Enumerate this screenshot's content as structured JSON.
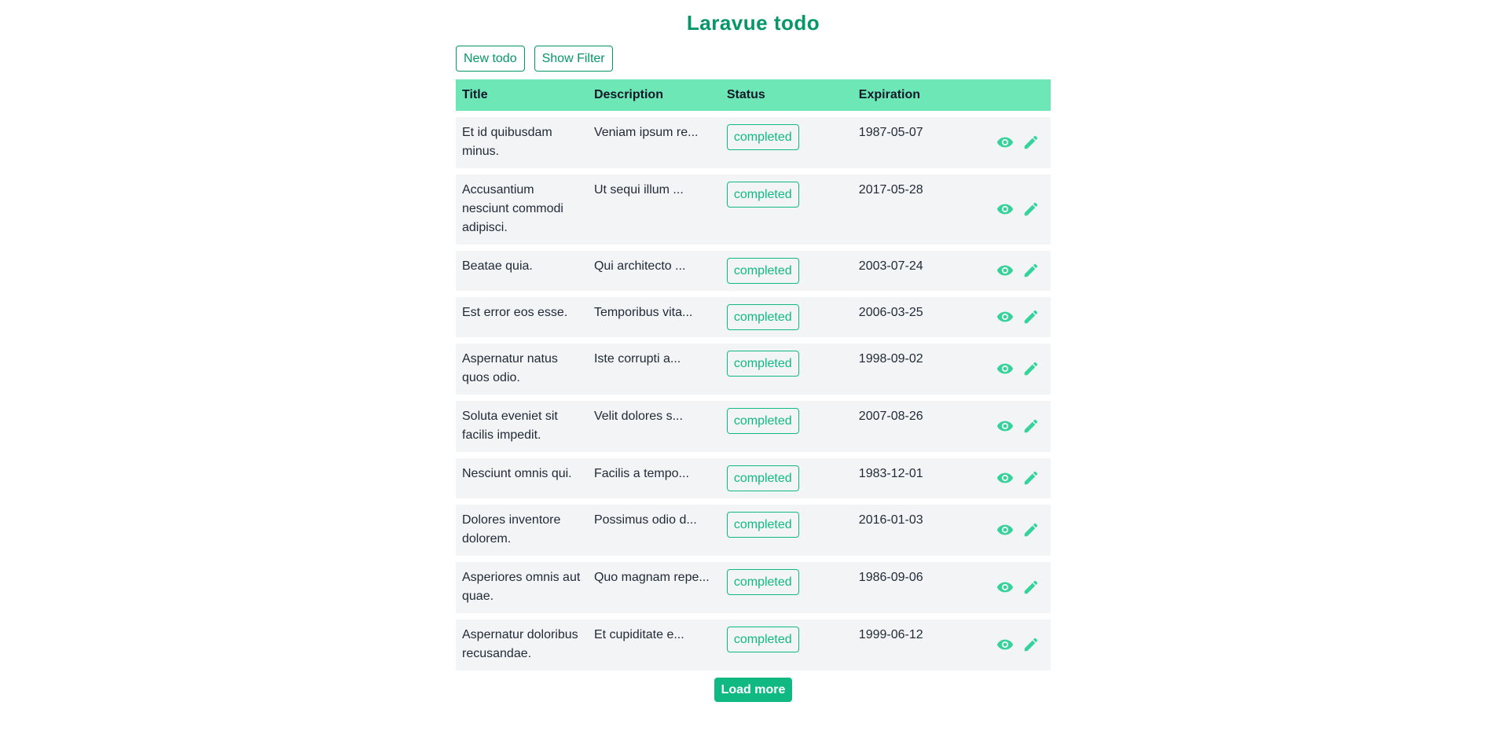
{
  "app": {
    "title": "Laravue todo"
  },
  "toolbar": {
    "new_todo_label": "New todo",
    "show_filter_label": "Show Filter"
  },
  "table": {
    "headers": {
      "title": "Title",
      "description": "Description",
      "status": "Status",
      "expiration": "Expiration"
    },
    "rows": [
      {
        "title": "Et id quibusdam minus.",
        "description": "Veniam ipsum re...",
        "status": "completed",
        "expiration": "1987-05-07"
      },
      {
        "title": "Accusantium nesciunt commodi adipisci.",
        "description": "Ut sequi illum ...",
        "status": "completed",
        "expiration": "2017-05-28"
      },
      {
        "title": "Beatae quia.",
        "description": "Qui architecto ...",
        "status": "completed",
        "expiration": "2003-07-24"
      },
      {
        "title": "Est error eos esse.",
        "description": "Temporibus vita...",
        "status": "completed",
        "expiration": "2006-03-25"
      },
      {
        "title": "Aspernatur natus quos odio.",
        "description": "Iste corrupti a...",
        "status": "completed",
        "expiration": "1998-09-02"
      },
      {
        "title": "Soluta eveniet sit facilis impedit.",
        "description": "Velit dolores s...",
        "status": "completed",
        "expiration": "2007-08-26"
      },
      {
        "title": "Nesciunt omnis qui.",
        "description": "Facilis a tempo...",
        "status": "completed",
        "expiration": "1983-12-01"
      },
      {
        "title": "Dolores inventore dolorem.",
        "description": "Possimus odio d...",
        "status": "completed",
        "expiration": "2016-01-03"
      },
      {
        "title": "Asperiores omnis aut quae.",
        "description": "Quo magnam repe...",
        "status": "completed",
        "expiration": "1986-09-06"
      },
      {
        "title": "Aspernatur doloribus recusandae.",
        "description": "Et cupiditate e...",
        "status": "completed",
        "expiration": "1999-06-12"
      }
    ],
    "row_icons": [
      "eye-icon",
      "pencil-icon"
    ]
  },
  "footer": {
    "load_more_label": "Load more"
  },
  "colors": {
    "brand": "#059669",
    "accent": "#10b981",
    "header_bg": "#6ee7b7",
    "row_bg": "#f3f4f6"
  }
}
